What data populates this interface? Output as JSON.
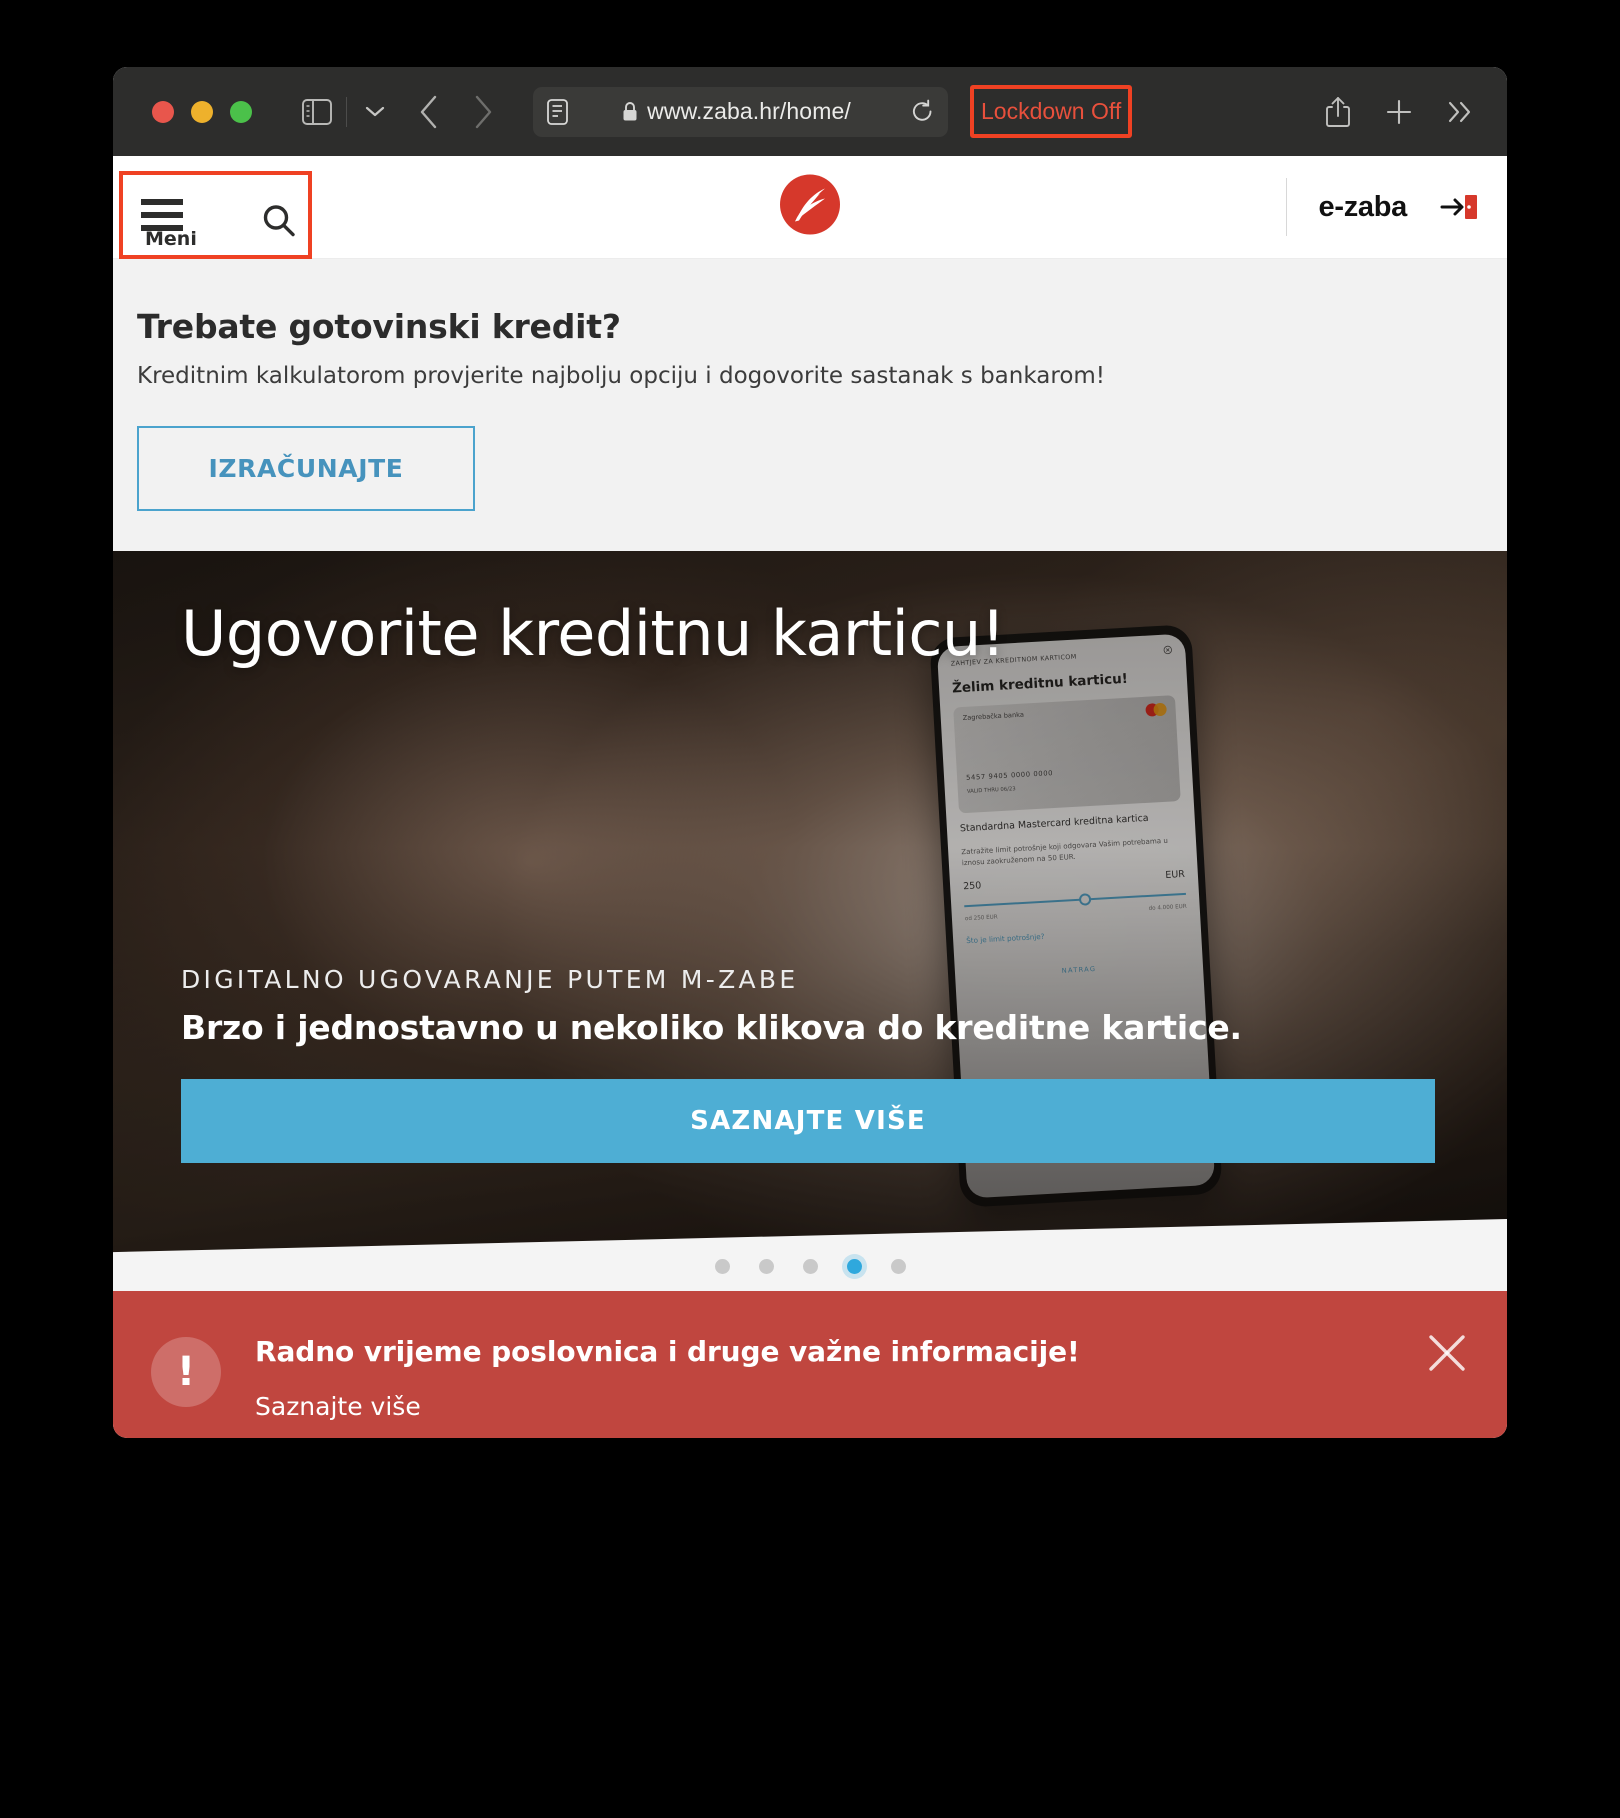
{
  "browser": {
    "url": "www.zaba.hr/home/",
    "lockdown_label": "Lockdown Off",
    "icons": {
      "sidebar": "sidebar-icon",
      "chevron": "chevron-down-icon",
      "back": "back-icon",
      "forward": "forward-icon",
      "reader": "reader-view-icon",
      "lock": "lock-icon",
      "reload": "reload-icon",
      "share": "share-icon",
      "new_tab": "plus-icon",
      "more": "chevron-double-right-icon"
    }
  },
  "site_header": {
    "menu_label": "Meni",
    "search_icon": "search-icon",
    "logo_alt": "zaba-logo",
    "ezaba_label": "e-zaba",
    "login_icon": "login-icon"
  },
  "promo": {
    "heading": "Trebate gotovinski kredit?",
    "subheading": "Kreditnim kalkulatorom provjerite najbolju opciju i dogovorite sastanak s bankarom!",
    "button_label": "IZRAČUNAJTE",
    "accent_color": "#4ba3cd"
  },
  "hero": {
    "title": "Ugovorite kreditnu karticu!",
    "kicker": "DIGITALNO UGOVARANJE PUTEM M-ZABE",
    "subtitle": "Brzo i jednostavno u nekoliko klikova do kreditne kartice.",
    "cta_label": "SAZNAJTE VIŠE",
    "cta_color": "#4eaed4",
    "slide_count": 5,
    "active_slide": 4,
    "phone": {
      "top_label": "ZAHTJEV ZA KREDITNOM KARTICOM",
      "close_icon": "close-circle-icon",
      "title": "Želim kreditnu karticu!",
      "card_brand": "Zagrebačka banka",
      "card_number": "5457 9405 0000 0000",
      "card_expiry": "VALID THRU 06/23",
      "product": "Standardna Mastercard kreditna kartica",
      "body": "Zatražite limit potrošnje koji odgovara Vašim potrebama u iznosu zaokruženom na 50 EUR.",
      "amount": "250",
      "currency": "EUR",
      "range_min": "od 250 EUR",
      "range_max": "do 4.000 EUR",
      "link": "Što je limit potrošnje?",
      "back_label": "NATRAG"
    }
  },
  "alert": {
    "icon": "exclamation-icon",
    "icon_glyph": "!",
    "title": "Radno vrijeme poslovnica i druge važne informacije!",
    "link_label": "Saznajte više",
    "close_icon": "close-icon",
    "background_color": "#c0463f"
  }
}
